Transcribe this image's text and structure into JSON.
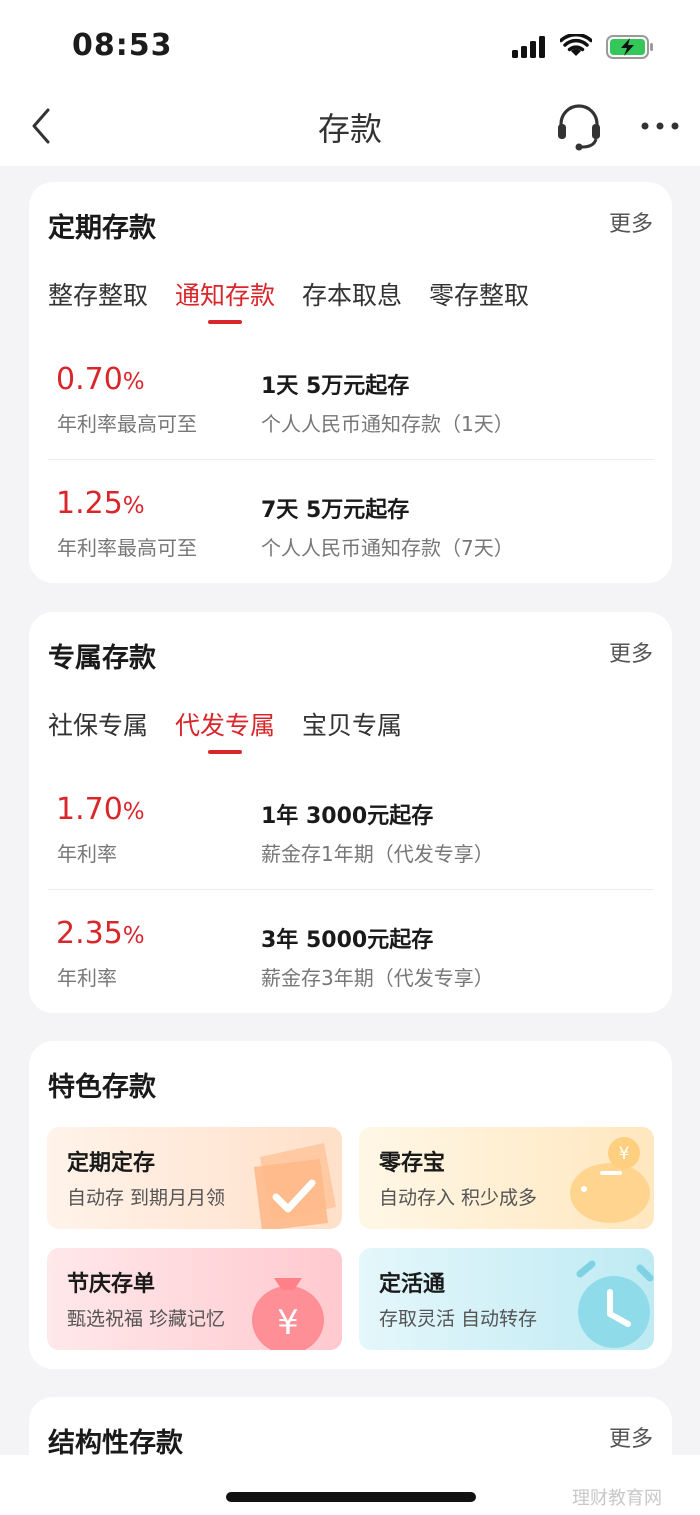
{
  "status_bar": {
    "time": "08:53"
  },
  "nav": {
    "title": "存款"
  },
  "fixed_deposit": {
    "title": "定期存款",
    "more": "更多",
    "tabs": [
      "整存整取",
      "通知存款",
      "存本取息",
      "零存整取"
    ],
    "active_tab": "通知存款",
    "products": [
      {
        "rate": "0.70",
        "pct": "%",
        "rate_label": "年利率最高可至",
        "title": "1天 5万元起存",
        "subtitle": "个人人民币通知存款（1天）"
      },
      {
        "rate": "1.25",
        "pct": "%",
        "rate_label": "年利率最高可至",
        "title": "7天 5万元起存",
        "subtitle": "个人人民币通知存款（7天）"
      }
    ]
  },
  "exclusive_deposit": {
    "title": "专属存款",
    "more": "更多",
    "tabs": [
      "社保专属",
      "代发专属",
      "宝贝专属"
    ],
    "active_tab": "代发专属",
    "products": [
      {
        "rate": "1.70",
        "pct": "%",
        "rate_label": "年利率",
        "title": "1年 3000元起存",
        "subtitle": "薪金存1年期（代发专享）"
      },
      {
        "rate": "2.35",
        "pct": "%",
        "rate_label": "年利率",
        "title": "3年 5000元起存",
        "subtitle": "薪金存3年期（代发专享）"
      }
    ]
  },
  "featured_deposit": {
    "title": "特色存款",
    "tiles": [
      {
        "title": "定期定存",
        "subtitle": "自动存 到期月月领",
        "icon": "wallet-check-icon"
      },
      {
        "title": "零存宝",
        "subtitle": "自动存入 积少成多",
        "icon": "piggy-bank-icon"
      },
      {
        "title": "节庆存单",
        "subtitle": "甄选祝福 珍藏记忆",
        "icon": "money-bag-icon"
      },
      {
        "title": "定活通",
        "subtitle": "存取灵活 自动转存",
        "icon": "alarm-clock-icon"
      }
    ]
  },
  "structured_deposit": {
    "title": "结构性存款",
    "more": "更多"
  },
  "watermark": "理财教育网",
  "colors": {
    "accent": "#d9262b",
    "page_bg": "#f4f4f6",
    "card_bg": "#ffffff"
  }
}
